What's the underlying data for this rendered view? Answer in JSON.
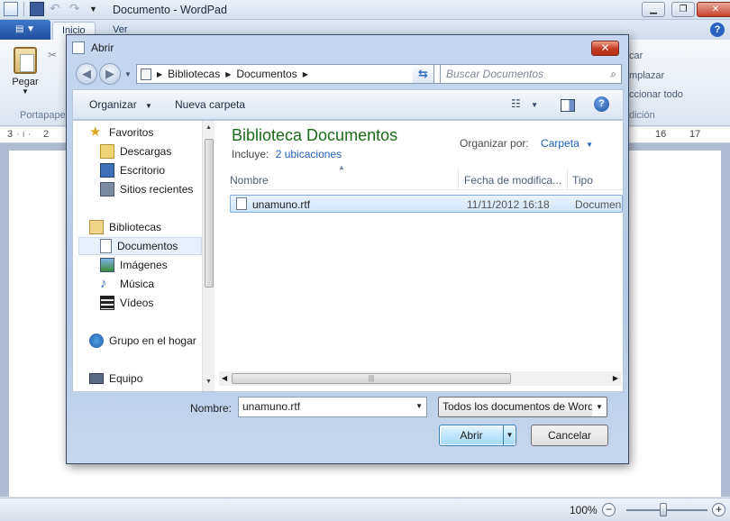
{
  "wordpad": {
    "title": "Documento - WordPad",
    "tabs": [
      "Inicio",
      "Ver"
    ],
    "paste_label": "Pegar",
    "clipboard_group": "Portapape",
    "right_items": [
      "car",
      "mplazar",
      "ccionar todo",
      "dición"
    ],
    "ruler": [
      "3",
      "2",
      "16",
      "17"
    ],
    "zoom": "100%"
  },
  "dialog": {
    "title": "Abrir",
    "close_glyph": "✕",
    "address": [
      "Bibliotecas",
      "Documentos"
    ],
    "search_placeholder": "Buscar Documentos",
    "toolbar": {
      "organize": "Organizar",
      "new_folder": "Nueva carpeta"
    },
    "nav": {
      "favorites": "Favoritos",
      "downloads": "Descargas",
      "desktop": "Escritorio",
      "recent": "Sitios recientes",
      "libraries": "Bibliotecas",
      "documents": "Documentos",
      "images": "Imágenes",
      "music": "Música",
      "videos": "Vídeos",
      "homegroup": "Grupo en el hogar",
      "computer": "Equipo"
    },
    "library": {
      "title": "Biblioteca Documentos",
      "includes_label": "Incluye:",
      "includes_link": "2 ubicaciones",
      "arrange_label": "Organizar por:",
      "arrange_value": "Carpeta"
    },
    "columns": [
      "Nombre",
      "Fecha de modifica...",
      "Tipo"
    ],
    "files": [
      {
        "name": "unamuno.rtf",
        "date": "11/11/2012 16:18",
        "type": "Documen"
      }
    ],
    "bottom": {
      "name_label": "Nombre:",
      "name_value": "unamuno.rtf",
      "filetype": "Todos los documentos de Word",
      "open": "Abrir",
      "cancel": "Cancelar"
    }
  },
  "colors": {
    "library_title": "#1c6a1c",
    "link": "#1f5fb7",
    "close_red": "#c33a21"
  }
}
